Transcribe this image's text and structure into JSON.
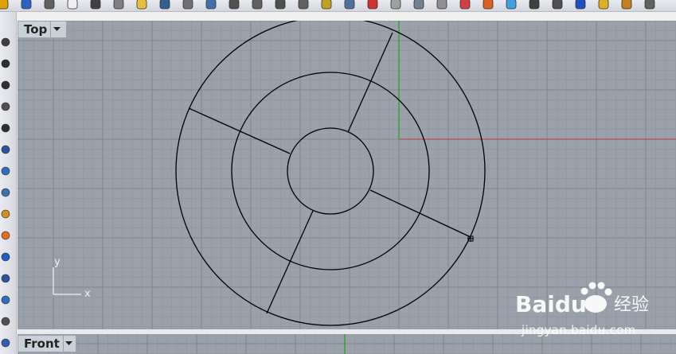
{
  "viewports": {
    "top": {
      "label": "Top",
      "axis_x": "x",
      "axis_y": "y"
    },
    "front": {
      "label": "Front"
    }
  },
  "watermark": {
    "brand": "Baidu",
    "cn": "经验",
    "url": "jingyan.baidu.com"
  },
  "colors": {
    "viewport_bg": "#9aa1aa",
    "grid_minor": "#8d959e",
    "grid_major": "#7d858e",
    "axis_x": "#b04040",
    "axis_y": "#3aa03a",
    "curve": "#000000"
  },
  "toolbar_icons": [
    "open-icon",
    "save-icon",
    "print-icon",
    "new-document-icon",
    "cut-icon",
    "copy-icon",
    "paste-icon",
    "undo-icon",
    "pan-icon",
    "rotate-icon",
    "zoom-icon",
    "zoom-window-icon",
    "zoom-extents-icon",
    "zoom-selected-icon",
    "zoom-target-icon",
    "four-viewports-icon",
    "car-icon",
    "layer-icon",
    "properties-icon",
    "light-icon",
    "material-icon",
    "render-icon",
    "color-wheel-icon",
    "shade-icon",
    "rendered-icon",
    "globe-icon",
    "options-icon",
    "tools-icon",
    "settings-icon"
  ],
  "left_toolbar_icons": [
    "point-icon",
    "polyline-icon",
    "curve-icon",
    "circle-icon",
    "arc-icon",
    "ellipse-icon",
    "surface-icon",
    "sphere-icon",
    "solid-icon",
    "transform-icon",
    "boolean-icon",
    "point-edit-icon",
    "group-icon",
    "dimension-icon",
    "analyze-icon"
  ]
}
